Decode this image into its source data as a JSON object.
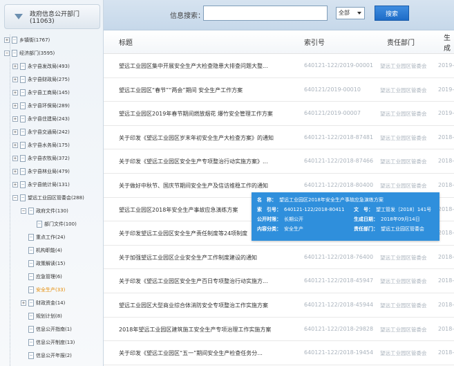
{
  "tree": {
    "root_label": "政府信息公开部门 (11063)",
    "nodes": [
      {
        "label": "乡镇街(1767)",
        "toggle": "+",
        "level": 0
      },
      {
        "label": "经济部门(3595)",
        "toggle": "−",
        "level": 0
      },
      {
        "label": "永宁县发改局(493)",
        "toggle": "+",
        "level": 1
      },
      {
        "label": "永宁县财政局(275)",
        "toggle": "+",
        "level": 1
      },
      {
        "label": "永宁县工商局(145)",
        "toggle": "+",
        "level": 1
      },
      {
        "label": "永宁县环保局(289)",
        "toggle": "+",
        "level": 1
      },
      {
        "label": "永宁县住建局(243)",
        "toggle": "+",
        "level": 1
      },
      {
        "label": "永宁县交通局(242)",
        "toggle": "+",
        "level": 1
      },
      {
        "label": "永宁县水务局(175)",
        "toggle": "+",
        "level": 1
      },
      {
        "label": "永宁县农牧局(372)",
        "toggle": "+",
        "level": 1
      },
      {
        "label": "永宁县林业局(479)",
        "toggle": "+",
        "level": 1
      },
      {
        "label": "永宁县统计局(131)",
        "toggle": "+",
        "level": 1
      },
      {
        "label": "望远工业园区管委会(288)",
        "toggle": "−",
        "level": 1
      },
      {
        "label": "政府文件(130)",
        "toggle": "−",
        "level": 2
      },
      {
        "label": "部门文件(100)",
        "toggle": "",
        "level": 3
      },
      {
        "label": "重点工作(24)",
        "toggle": "",
        "level": 2
      },
      {
        "label": "机构职能(4)",
        "toggle": "",
        "level": 2
      },
      {
        "label": "政策解读(15)",
        "toggle": "",
        "level": 2
      },
      {
        "label": "应急管理(6)",
        "toggle": "",
        "level": 2
      },
      {
        "label": "安全生产(33)",
        "toggle": "",
        "level": 2,
        "selected": true
      },
      {
        "label": "财政资金(14)",
        "toggle": "+",
        "level": 2
      },
      {
        "label": "规划计划(8)",
        "toggle": "",
        "level": 2
      },
      {
        "label": "信息公开指南(1)",
        "toggle": "",
        "level": 2
      },
      {
        "label": "信息公开制度(13)",
        "toggle": "",
        "level": 2
      },
      {
        "label": "信息公开年报(2)",
        "toggle": "",
        "level": 2
      }
    ]
  },
  "search": {
    "label": "信息搜索：",
    "value": "",
    "scope": "全部",
    "button": "搜索"
  },
  "table": {
    "headers": {
      "title": "标题",
      "index": "索引号",
      "dept": "责任部门",
      "date": "生成"
    },
    "rows": [
      {
        "title": "望远工业园区集中开展安全生产大检查隐患大排查问题大整...",
        "index": "640121-122/2019-00001",
        "dept": "望远工业园区管委会",
        "date": "2019-0"
      },
      {
        "title": "望远工业园区“春节”“两会”期间 安全生产工作方案",
        "index": "640121/2019-00010",
        "dept": "望远工业园区管委会",
        "date": "2019-0"
      },
      {
        "title": "望远工业园区2019年春节期间燃放烟花 爆竹安全管理工作方案",
        "index": "640121/2019-00007",
        "dept": "望远工业园区管委会",
        "date": "2019-0"
      },
      {
        "title": "关于印发《望远工业园区岁末年初安全生产大检查方案》的通知",
        "index": "640121-122/2018-87481",
        "dept": "望远工业园区管委会",
        "date": "2018-1"
      },
      {
        "title": "关于印发《望远工业园区安全生产专项整治行动实施方案》...",
        "index": "640121-122/2018-87466",
        "dept": "望远工业园区管委会",
        "date": "2018-1"
      },
      {
        "title": "关于做好中秋节、国庆节期间安全生产及信访维稳工作的通知",
        "index": "640121-122/2018-80400",
        "dept": "望远工业园区管委会",
        "date": "2018-0"
      },
      {
        "title": "望远工业园区2018年安全生产事故应急演练方案",
        "index": "",
        "dept": "",
        "date": "2018-0"
      },
      {
        "title": "关于印发望远工业园区安全生产责任制度等24项制度",
        "index": "",
        "dept": "",
        "date": "2018-0"
      },
      {
        "title": "关于加强望远工业园区企业安全生产工作制度建设的通知",
        "index": "640121-122/2018-76400",
        "dept": "望远工业园区管委会",
        "date": "2018-0"
      },
      {
        "title": "关于印发《望远工业园区安全生产百日专项整治行动实施方...",
        "index": "640121-122/2018-45947",
        "dept": "望远工业园区管委会",
        "date": "2018-0"
      },
      {
        "title": "望远工业园区大型商业综合体消防安全专项整治工作实施方案",
        "index": "640121-122/2018-45944",
        "dept": "望远工业园区管委会",
        "date": "2018-0"
      },
      {
        "title": "2018年望远工业园区建筑施工安全生产专项治理工作实施方案",
        "index": "640121-122/2018-29828",
        "dept": "望远工业园区管委会",
        "date": "2018-0"
      },
      {
        "title": "关于印发《望远工业园区“五一”期间安全生产检查任务分...",
        "index": "640121-122/2018-19454",
        "dept": "望远工业园区管委会",
        "date": "2018-0"
      }
    ]
  },
  "tooltip": {
    "name_label": "名　称：",
    "name": "望远工业园区2018年安全生产事故应急演练方案",
    "index_label": "索　引号：",
    "index": "640121-122/2018-80411",
    "docno_label": "文　号：",
    "docno": "望工管发〔2018〕141号",
    "open_label": "公开时限：",
    "open": "长期公开",
    "date_label": "生成日期：",
    "date": "2018年09月14日",
    "category_label": "内容分类：",
    "category": "安全生产",
    "dept_label": "责任部门：",
    "dept": "望远工业园区管委会"
  }
}
